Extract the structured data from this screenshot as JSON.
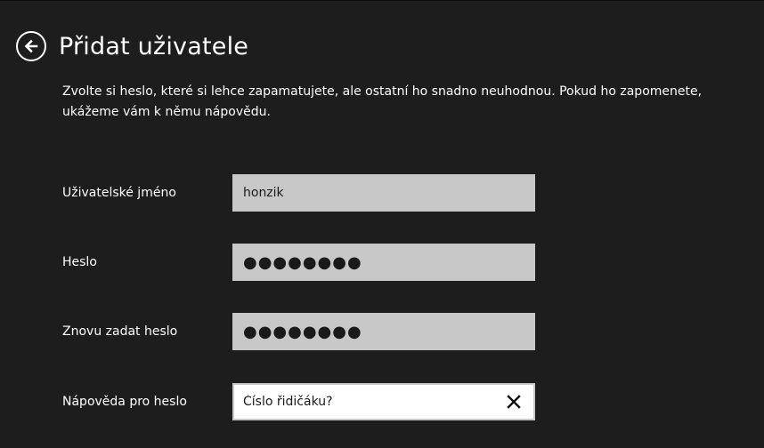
{
  "header": {
    "title": "Přidat uživatele",
    "back_icon": "arrow-left-circle-icon"
  },
  "description": "Zvolte si heslo, které si lehce zapamatujete, ale ostatní ho snadno neuhodnou. Pokud ho zapomenete, ukážeme vám k němu nápovědu.",
  "form": {
    "username": {
      "label": "Uživatelské jméno",
      "value": "honzik"
    },
    "password": {
      "label": "Heslo",
      "value": "●●●●●●●●"
    },
    "password_confirm": {
      "label": "Znovu zadat heslo",
      "value": "●●●●●●●●"
    },
    "password_hint": {
      "label": "Nápověda pro heslo",
      "value": "Číslo řidičáku?",
      "clear_icon": "close-icon"
    }
  },
  "colors": {
    "background": "#1d1d1d",
    "text": "#ffffff",
    "field_inactive": "#c8c8c8",
    "field_active": "#ffffff"
  }
}
